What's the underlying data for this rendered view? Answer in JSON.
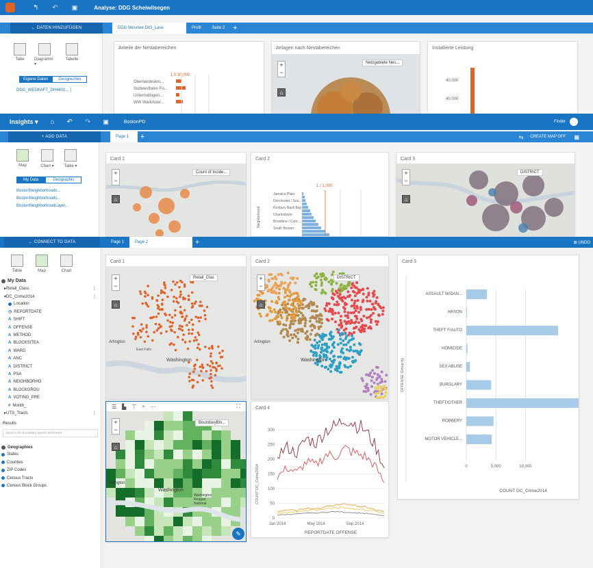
{
  "layer1": {
    "title": "Analyse: DDG Scheiwilsegen",
    "connect": "← DATEN HINZUFÜGEN",
    "tabs": [
      "DDG Wesnwe DIG_Lase",
      "Profil",
      "Seite 2"
    ],
    "tools": [
      "Tabe",
      "Diagramm ▾",
      "Tabelle"
    ],
    "seg": [
      "Eigene Daten",
      "Geogrechen"
    ],
    "dataset": "DDG_WEDKAFT_DH4401... │",
    "cards": [
      "Anteile der Nestabereichen",
      "Anlagen nach Nestabereichen",
      "Installierte Leistung"
    ],
    "bar_rows": [
      "Oberlandeskm...",
      "Südwestfalen Fo...",
      "Unterrodingen...",
      "WW Warkrister..."
    ],
    "bar_value": "1.0  30,000",
    "map_legend": "Netzgebiete Nes...",
    "right_ticks": [
      "40.000",
      "40.000"
    ]
  },
  "layer2": {
    "app": "Insights ▾",
    "project": "BostonPD",
    "user": "Finder",
    "connect": "+ ADD DATA",
    "tab": "Page 1",
    "toggle": "CREATE MAP  OFF",
    "tools": [
      "Map",
      "Chart ▾",
      "Table ▾"
    ],
    "seg": [
      "My Data",
      "Geographic"
    ],
    "datasets": [
      "BostonNeighborhoods...",
      "BostonNeighborhoods...",
      "BostonNeighborhoodLayer..."
    ],
    "cards": [
      "Card 1",
      "Card 2",
      "Card 3"
    ],
    "legend1": "Count of Incide...",
    "legend3": "DISTRICT",
    "card2_rows": [
      "Jamaica Plain",
      "Dorchester / Sou...",
      "Roxbury Back Bay",
      "Charlestown",
      "Brookline / Cent...",
      "South Boston"
    ],
    "card2_value": "1 / 1,000",
    "card2_axis": "Neighborhood"
  },
  "layer3": {
    "connect": "← CONNECT TO DATA",
    "tabs": [
      "Page 1",
      "Page 2"
    ],
    "right_hint": "⊞ UNDO",
    "tools": [
      "Table",
      "Map",
      "Chart"
    ],
    "my_data": "My Data",
    "datasets": [
      {
        "label": "▸Retail_Class",
        "type": "ds"
      },
      {
        "label": "▾DC_Crime2014",
        "type": "ds"
      },
      {
        "label": "Location",
        "type": "geo"
      },
      {
        "label": "REPORTDATE",
        "type": "date"
      },
      {
        "label": "SHIFT",
        "type": "str"
      },
      {
        "label": "OFFENSE",
        "type": "str"
      },
      {
        "label": "METHOD",
        "type": "str"
      },
      {
        "label": "BLOCKSITEA",
        "type": "str"
      },
      {
        "label": "WARD",
        "type": "str"
      },
      {
        "label": "ANC",
        "type": "str"
      },
      {
        "label": "DISTRICT",
        "type": "str"
      },
      {
        "label": "PSA",
        "type": "str"
      },
      {
        "label": "NEIGHBORHO",
        "type": "str"
      },
      {
        "label": "BLOCKGROU",
        "type": "str"
      },
      {
        "label": "VOTING_PRE",
        "type": "str"
      },
      {
        "label": "Month_",
        "type": "num"
      },
      {
        "label": "▸UTS_Tracts",
        "type": "ds"
      }
    ],
    "results": "Results",
    "search_placeholder": "Search for boundary layers and more",
    "geo_header": "Geographies",
    "geos": [
      "States",
      "Counties",
      "ZIP Codes",
      "Census Tracts",
      "Census Block Groups"
    ],
    "cards": [
      "Card 1",
      "Card 2",
      "Card 3",
      "Card 4"
    ],
    "legend1": "Retail_Clas",
    "legend2": "DISTRICT",
    "legend4": "BoundaryBlo...",
    "map_labels": {
      "city": "Washington",
      "west": "Arlington",
      "other": "East Falls",
      "park": "Washington Reagan National"
    },
    "card3": {
      "axis_y_label": "OFFENSE   Group by",
      "axis_x_label": "COUNT  DC_Crime2014",
      "categories": [
        "ASSAULT W/DAN...",
        "ARSON",
        "THEFT F/AUTO",
        "HOMICIDE",
        "SEX ABUSE",
        "BURGLARY",
        "THEFT/OTHER",
        "ROBBERY",
        "MOTOR VEHICLE..."
      ],
      "values": [
        3500,
        100,
        15500,
        200,
        600,
        4200,
        28500,
        4600,
        4300
      ],
      "ticks": [
        "0",
        "5,000",
        "10,000"
      ],
      "tick_values": [
        0,
        5000,
        10000
      ],
      "xmax": 19200
    },
    "card4": {
      "ylabel": "COUNT  DC_Crime2014",
      "xlabel": "REPORTDATE  OFFENSE",
      "yticks": [
        "300",
        "250",
        "200",
        "150",
        "100",
        "50",
        "0"
      ],
      "ytick_values": [
        300,
        250,
        200,
        150,
        100,
        50,
        0
      ],
      "xticks": [
        "Jan 2014",
        "May 2014",
        "Sep 2014"
      ]
    }
  },
  "chart_data": [
    {
      "type": "bar",
      "title": "Card 3",
      "categories": [
        "ASSAULT W/DAN...",
        "ARSON",
        "THEFT F/AUTO",
        "HOMICIDE",
        "SEX ABUSE",
        "BURGLARY",
        "THEFT/OTHER",
        "ROBBERY",
        "MOTOR VEHICLE..."
      ],
      "values": [
        3500,
        100,
        15500,
        200,
        600,
        4200,
        28500,
        4600,
        4300
      ],
      "xlabel": "COUNT  DC_Crime2014",
      "ylabel": "OFFENSE",
      "xlim": [
        0,
        19200
      ]
    },
    {
      "type": "line",
      "title": "Card 4",
      "x": [
        "Jan 2014",
        "Feb",
        "Mar",
        "Apr",
        "May 2014",
        "Jun",
        "Jul",
        "Aug",
        "Sep 2014",
        "Oct",
        "Nov",
        "Dec"
      ],
      "series": [
        {
          "values": [
            215,
            240,
            220,
            270,
            255,
            300,
            310,
            340,
            320,
            300,
            250,
            170
          ],
          "color": "#8e2f3a"
        },
        {
          "values": [
            140,
            170,
            155,
            190,
            180,
            215,
            210,
            235,
            220,
            210,
            180,
            120
          ],
          "color": "#d9534f"
        },
        {
          "values": [
            22,
            28,
            25,
            35,
            30,
            40,
            45,
            48,
            44,
            38,
            30,
            20
          ],
          "color": "#e6a23c"
        },
        {
          "values": [
            16,
            18,
            22,
            26,
            28,
            32,
            34,
            36,
            30,
            28,
            24,
            15
          ],
          "color": "#e8c95a"
        },
        {
          "values": [
            10,
            12,
            14,
            16,
            18,
            20,
            22,
            20,
            18,
            16,
            12,
            8
          ],
          "color": "#888888"
        }
      ],
      "xlabel": "REPORTDATE  OFFENSE",
      "ylabel": "COUNT  DC_Crime2014",
      "ylim": [
        0,
        340
      ]
    }
  ],
  "colors": {
    "brand": "#1a74c4",
    "bar": "#a8cbe8",
    "orange": "#e0632a"
  }
}
